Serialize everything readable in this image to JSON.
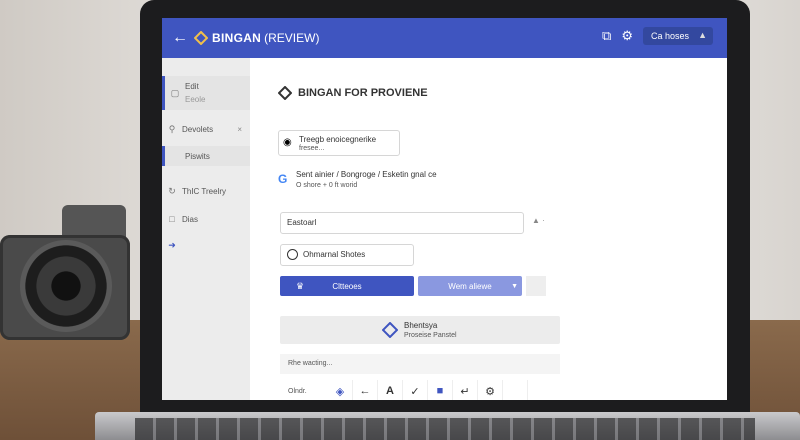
{
  "app": {
    "title": "BINGAN",
    "title_suffix": "(REVIEW)",
    "header_button": "Ca hoses",
    "accent_color": "#3f55c0"
  },
  "sidebar": {
    "items": [
      {
        "label": "Edit",
        "sub": "Eeole"
      },
      {
        "label": "Devolets"
      },
      {
        "label": "Piswits"
      },
      {
        "label": "ThIC Treelry"
      },
      {
        "label": "Dias"
      }
    ]
  },
  "main": {
    "page_title": "BINGAN FOR PROVIENE",
    "card1": {
      "line1": "Treegb enoicegnerike",
      "line2": "fresee..."
    },
    "info": {
      "line1": "Sent ainier / Bongroge / Esketin gnal ce",
      "line2": "O shore + 0 ft worid"
    },
    "input_value": "Eastoarl",
    "radio_label": "Ohmarnal Shotes",
    "btn_primary": "Cltteoes",
    "btn_secondary": "Wem aliewe",
    "banner": {
      "title": "Bhentsya",
      "subtitle": "Proseise Panstel"
    },
    "section_label": "Rhe wacting...",
    "toolbar_label": "Olndr."
  },
  "icons": {
    "back": "back-arrow-icon",
    "settings": "gear-icon",
    "copy": "copy-icon"
  }
}
